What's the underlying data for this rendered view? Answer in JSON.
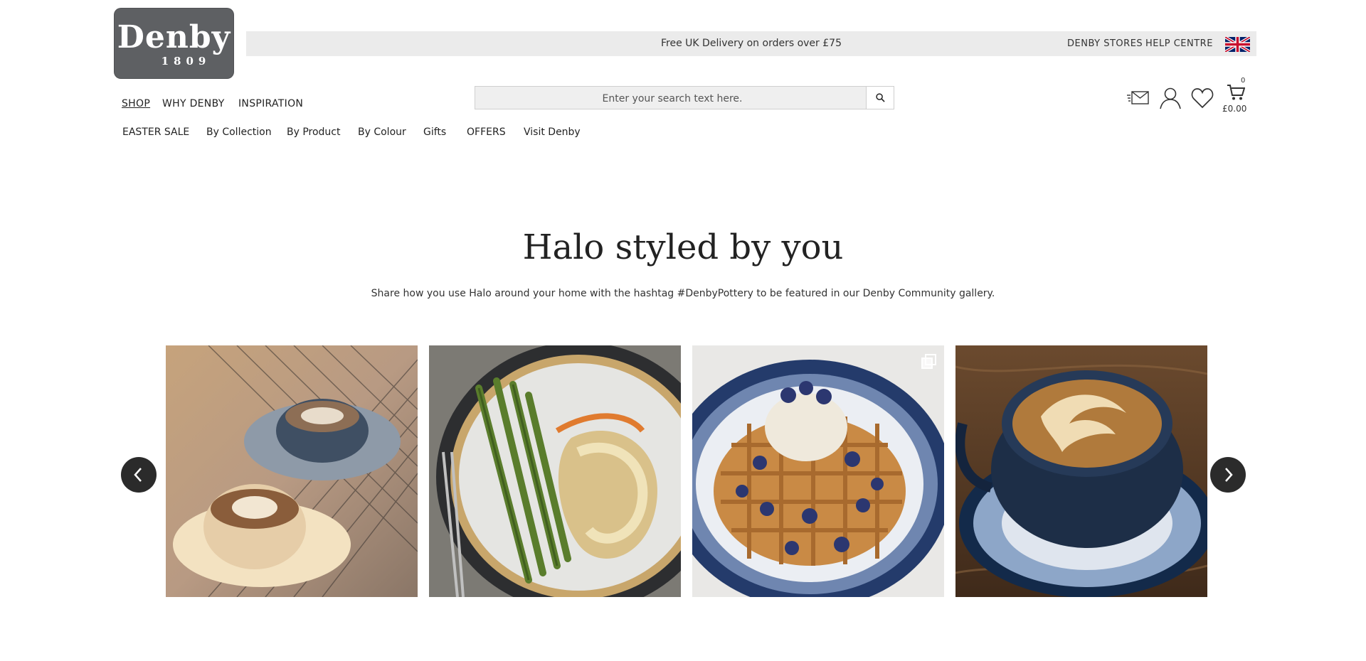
{
  "brand": {
    "name": "Denby",
    "year": "1809"
  },
  "topbar": {
    "delivery_message": "Free UK Delivery on orders over £75",
    "stores_link": "DENBY STORES",
    "help_link": "HELP CENTRE"
  },
  "primary_nav": {
    "shop": "SHOP",
    "why": "WHY DENBY",
    "inspiration": "INSPIRATION"
  },
  "secondary_nav": [
    "EASTER SALE",
    "By Collection",
    "By Product",
    "By Colour",
    "Gifts",
    "OFFERS",
    "Visit Denby"
  ],
  "search": {
    "placeholder": "Enter your search text here."
  },
  "basket": {
    "count": "0",
    "total": "£0.00"
  },
  "hero": {
    "title": "Halo styled by you",
    "subtitle": "Share how you use Halo around your home with the hashtag #DenbyPottery to be featured in our Denby Community gallery."
  },
  "icons": {
    "search": "search-icon",
    "store": "store-locator-icon",
    "account": "account-icon",
    "wishlist": "heart-icon",
    "basket": "basket-icon",
    "flag": "uk-flag-icon",
    "prev": "chevron-left-icon",
    "next": "chevron-right-icon",
    "multi": "multiple-images-icon"
  },
  "colors": {
    "logo_bg": "#5e6063",
    "topbar_bg": "#ebebeb",
    "arrow_bg": "#2b2b2b"
  }
}
